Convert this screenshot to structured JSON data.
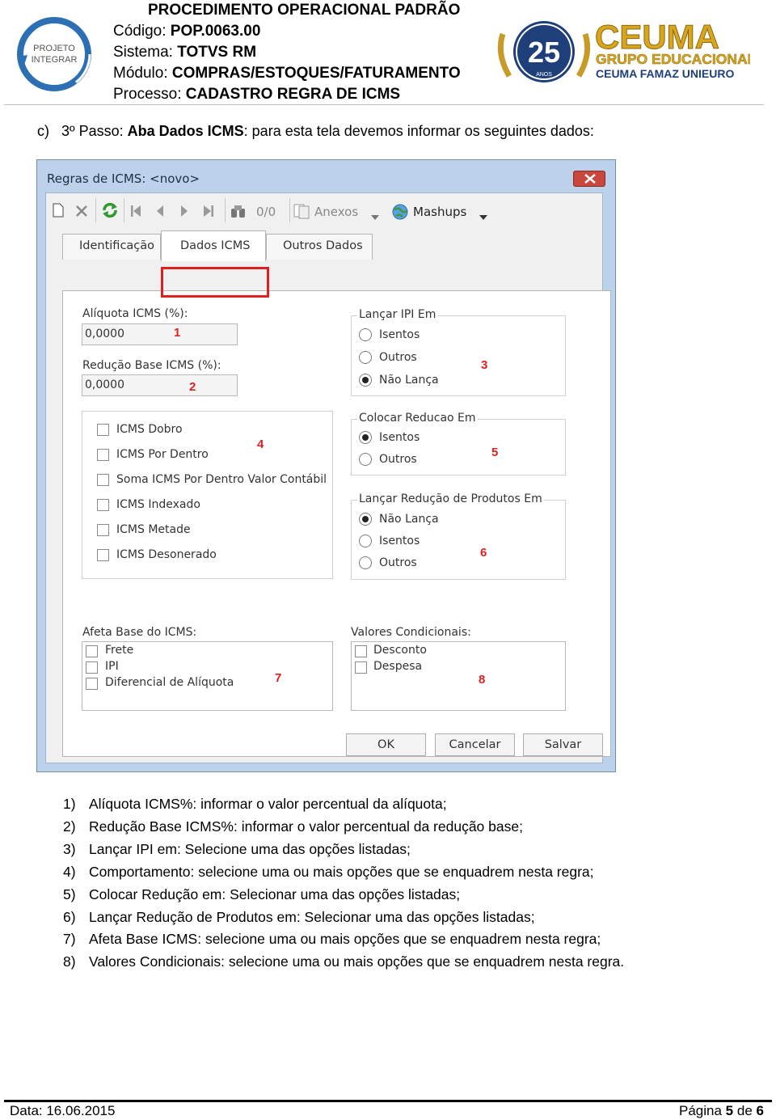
{
  "header": {
    "title": "PROCEDIMENTO OPERACIONAL PADRÃO",
    "lines": [
      {
        "label": "Código: ",
        "value": "POP.0063.00"
      },
      {
        "label": "Sistema: ",
        "value": "TOTVS RM"
      },
      {
        "label": "Módulo: ",
        "value": "COMPRAS/ESTOQUES/FATURAMENTO"
      },
      {
        "label": "Processo: ",
        "value": "CADASTRO REGRA DE ICMS"
      }
    ],
    "logo_left_text": [
      "PROJETO",
      "INTEGRAR"
    ],
    "logo_right": {
      "anos": "25",
      "anos_label": "ANOS",
      "brand": "CEUMA",
      "subtitle": "GRUPO EDUCACIONAL",
      "units": "CEUMA FAMAZ UNIEURO"
    }
  },
  "step": {
    "prefix": "c)",
    "text_pre": "3º Passo: ",
    "bold": "Aba Dados ICMS",
    "text_post": ": para esta tela devemos informar os seguintes dados:"
  },
  "dialog": {
    "title": "Regras de ICMS: <novo>",
    "toolbar": {
      "counter": "0/0",
      "anexos": "Anexos",
      "mashups": "Mashups"
    },
    "tabs": [
      "Identificação",
      "Dados ICMS",
      "Outros Dados"
    ],
    "aliquota": {
      "label": "Alíquota ICMS (%):",
      "value": "0,0000"
    },
    "reducao": {
      "label": "Redução Base ICMS (%):",
      "value": "0,0000"
    },
    "lancar_ipi": {
      "title": "Lançar IPI Em",
      "options": [
        "Isentos",
        "Outros",
        "Não Lança"
      ],
      "selected": "Não Lança"
    },
    "comportamento": [
      "ICMS Dobro",
      "ICMS Por Dentro",
      "Soma ICMS Por Dentro Valor Contábil",
      "ICMS Indexado",
      "ICMS Metade",
      "ICMS Desonerado"
    ],
    "colocar_reducao": {
      "title": "Colocar Reducao Em",
      "options": [
        "Isentos",
        "Outros"
      ],
      "selected": "Isentos"
    },
    "lancar_reducao": {
      "title": "Lançar Redução de Produtos Em",
      "options": [
        "Não Lança",
        "Isentos",
        "Outros"
      ],
      "selected": "Não Lança"
    },
    "afeta_base": {
      "title": "Afeta Base do ICMS:",
      "options": [
        "Frete",
        "IPI",
        "Diferencial de Alíquota"
      ]
    },
    "valores_cond": {
      "title": "Valores Condicionais:",
      "options": [
        "Desconto",
        "Despesa"
      ]
    },
    "markers": [
      "1",
      "2",
      "3",
      "4",
      "5",
      "6",
      "7",
      "8"
    ],
    "buttons": {
      "ok": "OK",
      "cancel": "Cancelar",
      "save": "Salvar"
    }
  },
  "instructions": [
    {
      "n": "1)",
      "text": "Alíquota ICMS%: informar o valor percentual da alíquota;"
    },
    {
      "n": "2)",
      "text": "Redução Base ICMS%: informar o valor percentual da redução base;"
    },
    {
      "n": "3)",
      "text": "Lançar IPI em: Selecione uma das opções listadas;"
    },
    {
      "n": "4)",
      "text": "Comportamento: selecione uma ou mais opções que se enquadrem nesta regra;"
    },
    {
      "n": "5)",
      "text": "Colocar Redução em: Selecionar uma das opções listadas;"
    },
    {
      "n": "6)",
      "text": "Lançar Redução de Produtos em: Selecionar uma das opções listadas;"
    },
    {
      "n": "7)",
      "text": "Afeta Base ICMS: selecione uma ou mais opções que se enquadrem nesta regra;"
    },
    {
      "n": "8)",
      "text": "Valores Condicionais: selecione uma ou mais opções que se enquadrem nesta regra."
    }
  ],
  "footer": {
    "date": "Data: 16.06.2015",
    "page_prefix": "Página ",
    "page": "5",
    "page_mid": " de ",
    "total": "6"
  },
  "colors": {
    "highlight": "#e02020",
    "window_frame": "#bcd2ea",
    "gold": "#d8a51c",
    "navy": "#1e3f7a"
  }
}
